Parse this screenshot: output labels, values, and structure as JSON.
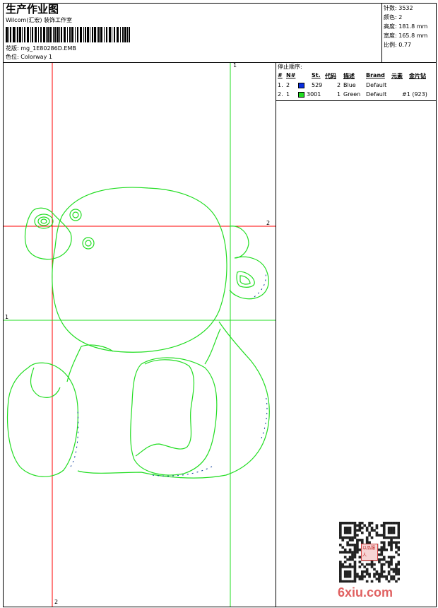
{
  "header": {
    "title": "生产作业图",
    "company": "Wilcom(汇宏) 装饰工作室",
    "design_label": "花版:",
    "design_value": "mg_1E80286D.EMB",
    "colorway_label": "色位:",
    "colorway_value": "Colorway 1"
  },
  "stats": [
    {
      "label": "针数:",
      "value": "3532"
    },
    {
      "label": "颜色:",
      "value": "2"
    },
    {
      "label": "高度:",
      "value": "181.8 mm"
    },
    {
      "label": "宽度:",
      "value": "165.8 mm"
    },
    {
      "label": "比例:",
      "value": "0.77"
    }
  ],
  "stop_sequence": {
    "title": "停止顺序:",
    "headers": {
      "num": "#",
      "n": "N#",
      "st": "St.",
      "code": "代码",
      "desc": "描述",
      "brand": "Brand",
      "elem": "元素",
      "sequin": "金片钻"
    },
    "rows": [
      {
        "num": "1.",
        "n": "2",
        "color": "#0a2ee0",
        "st": "529",
        "code": "2",
        "desc": "Blue",
        "brand": "Default",
        "elem": "",
        "sequin": ""
      },
      {
        "num": "2.",
        "n": "1",
        "color": "#22dd22",
        "st": "3001",
        "code": "1",
        "desc": "Green",
        "brand": "Default",
        "elem": "#1 (923)",
        "sequin": ""
      }
    ]
  },
  "guides": {
    "vertical_green_label": "1",
    "horizontal_red_label": "2",
    "horizontal_green_label": "1",
    "vertical_red_label": "2",
    "colors": {
      "red": "#ff0000",
      "green": "#22dd22",
      "outline": "#22dd22",
      "outline_dark": "#0a3a9a"
    }
  },
  "watermark": {
    "text": "6xiu.com",
    "seal_text": "以品服人",
    "color": "#e06060"
  }
}
